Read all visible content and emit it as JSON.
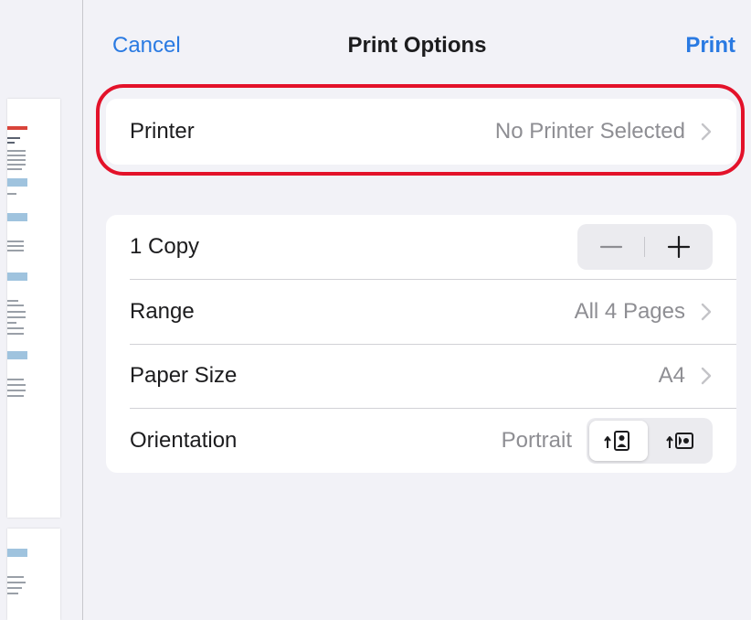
{
  "header": {
    "cancel_label": "Cancel",
    "title": "Print Options",
    "print_label": "Print"
  },
  "printer": {
    "label": "Printer",
    "value": "No Printer Selected"
  },
  "options": {
    "copies_label": "1 Copy",
    "range_label": "Range",
    "range_value": "All 4 Pages",
    "paper_size_label": "Paper Size",
    "paper_size_value": "A4",
    "orientation_label": "Orientation",
    "orientation_value": "Portrait",
    "orientation_options": [
      "portrait-icon",
      "landscape-icon"
    ]
  },
  "colors": {
    "accent": "#2a7ae2",
    "highlight": "#e3122a",
    "secondary_text": "#8e8e93"
  }
}
